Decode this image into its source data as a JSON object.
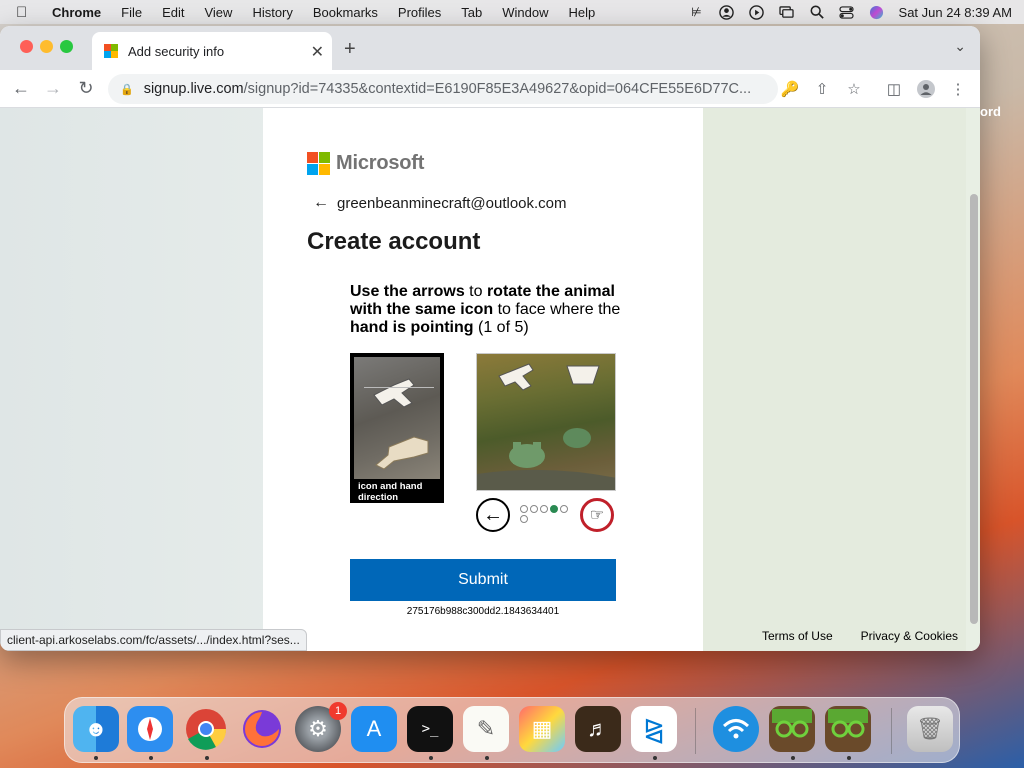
{
  "menubar": {
    "app": "Chrome",
    "items": [
      "File",
      "Edit",
      "View",
      "History",
      "Bookmarks",
      "Profiles",
      "Tab",
      "Window",
      "Help"
    ],
    "datetime": "Sat Jun 24  8:39 AM"
  },
  "browser": {
    "tab_title": "Add security info",
    "url_host": "signup.live.com",
    "url_path": "/signup?id=74335&contextid=E6190F85E3A49627&opid=064CFE55E6D77C...",
    "status_url": "client-api.arkoselabs.com/fc/assets/.../index.html?ses..."
  },
  "page": {
    "brand": "Microsoft",
    "email": "greenbeanminecraft@outlook.com",
    "title": "Create account",
    "instruction": {
      "p1": "Use the arrows",
      "p2": " to ",
      "p3": "rotate the animal with the same icon",
      "p4": " to face where the ",
      "p5": "hand is pointing",
      "p6": " (1 of 5)"
    },
    "ref_caption": "icon and hand direction",
    "submit_label": "Submit",
    "session_id": "275176b988c300dd2.1843634401",
    "pagination": {
      "total": 6,
      "active_index": 3
    },
    "footer": {
      "terms": "Terms of Use",
      "privacy": "Privacy & Cookies"
    },
    "peek_text": "ord"
  },
  "dock": {
    "settings_badge": "1"
  },
  "colors": {
    "ms_red": "#f25022",
    "ms_green": "#7fba00",
    "ms_blue": "#00a4ef",
    "ms_yellow": "#ffb900",
    "submit_blue": "#0067b8",
    "active_dot": "#2a8a52"
  }
}
